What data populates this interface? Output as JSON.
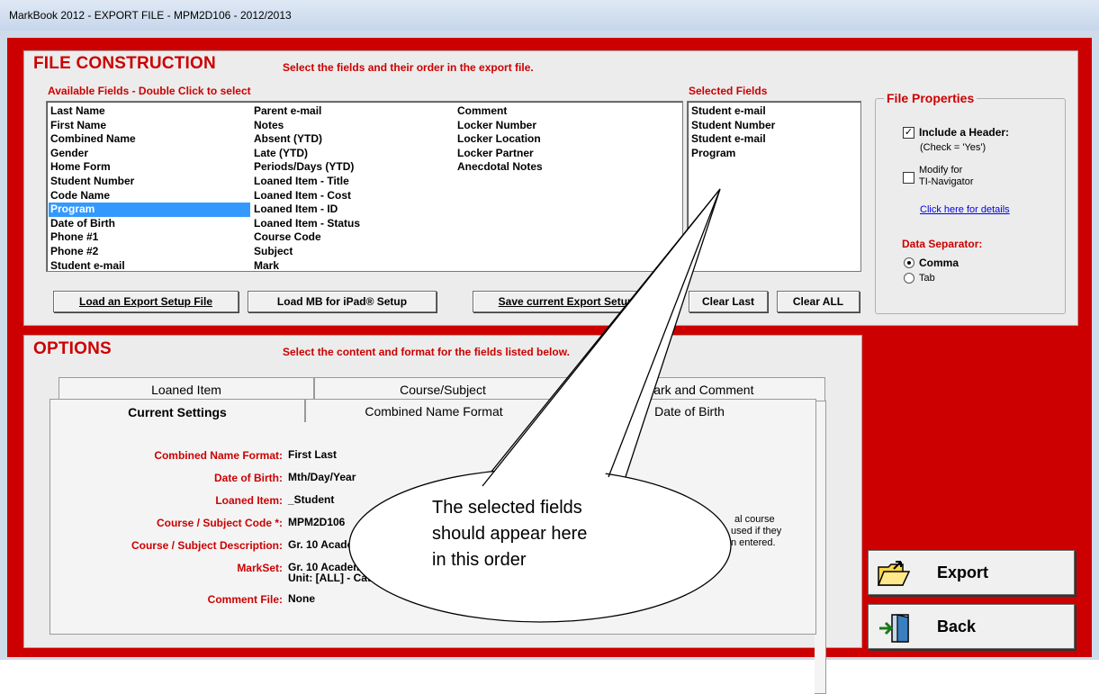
{
  "window": {
    "title": "MarkBook 2012 - EXPORT FILE - MPM2D106 - 2012/2013"
  },
  "file_construction": {
    "title": "FILE CONSTRUCTION",
    "subtitle": "Select the fields and their order in the export file.",
    "available_label": "Available Fields - Double Click to select",
    "selected_label": "Selected Fields",
    "available_fields": {
      "col1": [
        "Last Name",
        "First Name",
        "Combined Name",
        "Gender",
        "Home Form",
        "Student Number",
        "Code Name",
        "Program",
        "Date of Birth",
        "Phone #1",
        "Phone #2",
        "Student e-mail"
      ],
      "col2": [
        "Parent e-mail",
        "Notes",
        "Absent (YTD)",
        "Late (YTD)",
        "Periods/Days (YTD)",
        "Loaned Item - Title",
        "Loaned Item - Cost",
        "Loaned Item - ID",
        "Loaned Item - Status",
        "Course Code",
        "Subject",
        "Mark"
      ],
      "col3": [
        "Comment",
        "Locker Number",
        "Locker Location",
        "Locker Partner",
        "Anecdotal Notes"
      ]
    },
    "highlighted_field": "Program",
    "selected_fields": [
      "Student e-mail",
      "Student Number",
      "Student e-mail",
      "Program"
    ],
    "buttons": {
      "load_export": "Load an Export Setup File",
      "load_ipad": "Load MB for iPad® Setup",
      "save_export": "Save current Export Setup",
      "clear_last": "Clear Last",
      "clear_all": "Clear ALL"
    }
  },
  "file_properties": {
    "title": "File Properties",
    "include_header_label": "Include a Header:",
    "include_header_checked": true,
    "include_header_note": "(Check = 'Yes')",
    "modify_label_1": "Modify for",
    "modify_label_2": "TI-Navigator",
    "modify_checked": false,
    "details_link": "Click here for details",
    "separator_label": "Data Separator:",
    "separator_options": [
      "Comma",
      "Tab"
    ],
    "separator_selected": "Comma"
  },
  "options": {
    "title": "OPTIONS",
    "subtitle": "Select the content and format for the fields listed below.",
    "tabs_back": [
      "Loaned Item",
      "Course/Subject",
      "Mark and Comment"
    ],
    "tabs_front": [
      "Current Settings",
      "Combined Name Format",
      "Date of Birth"
    ],
    "active_tab": "Current Settings",
    "settings": [
      {
        "label": "Combined Name Format:",
        "value": "First Last"
      },
      {
        "label": "Date of Birth:",
        "value": "Mth/Day/Year"
      },
      {
        "label": "Loaned Item:",
        "value": "_Student"
      },
      {
        "label": "Course / Subject Code *:",
        "value": "MPM2D106"
      },
      {
        "label": "Course / Subject Description:",
        "value": "Gr. 10 Academic"
      },
      {
        "label": "MarkSet:",
        "value": "Gr. 10 Academic"
      },
      {
        "label": "Comment File:",
        "value": "None"
      }
    ],
    "markset_line2": "Unit: [ALL] - Cat: [",
    "note_lines": [
      "al course",
      "used if they",
      "n entered."
    ]
  },
  "actions": {
    "export": "Export",
    "back": "Back"
  },
  "callout": {
    "lines": [
      "The selected fields",
      "should appear here",
      "in this order"
    ]
  }
}
